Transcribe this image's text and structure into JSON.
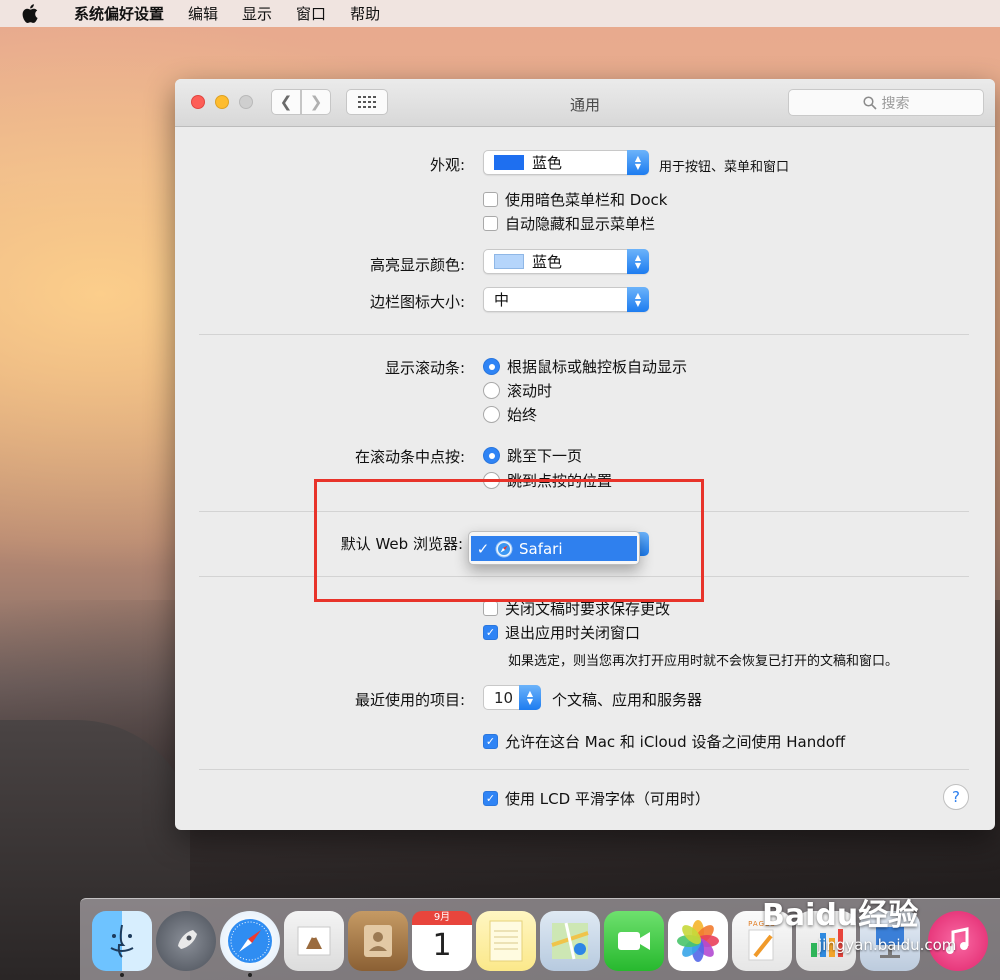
{
  "menubar": {
    "app": "系统偏好设置",
    "items": [
      "编辑",
      "显示",
      "窗口",
      "帮助"
    ]
  },
  "window": {
    "title": "通用",
    "search_placeholder": "搜索"
  },
  "appearance": {
    "label": "外观:",
    "value": "蓝色",
    "hint": "用于按钮、菜单和窗口",
    "swatch_color": "#1e6ff0",
    "dark_menu": "使用暗色菜单栏和 Dock",
    "auto_hide": "自动隐藏和显示菜单栏"
  },
  "highlight": {
    "label": "高亮显示颜色:",
    "value": "蓝色",
    "swatch_color": "#b5d5fb"
  },
  "sidebar_size": {
    "label": "边栏图标大小:",
    "value": "中"
  },
  "scrollbars": {
    "label": "显示滚动条:",
    "options": [
      "根据鼠标或触控板自动显示",
      "滚动时",
      "始终"
    ]
  },
  "click_scroll": {
    "label": "在滚动条中点按:",
    "options": [
      "跳至下一页",
      "跳到点按的位置"
    ]
  },
  "browser": {
    "label": "默认 Web 浏览器:",
    "tick": "✓",
    "value": "Safari"
  },
  "documents": {
    "ask_save": "关闭文稿时要求保存更改",
    "close_windows": "退出应用时关闭窗口",
    "note": "如果选定，则当您再次打开应用时就不会恢复已打开的文稿和窗口。"
  },
  "recent": {
    "label": "最近使用的项目:",
    "value": "10",
    "suffix": "个文稿、应用和服务器"
  },
  "handoff": "允许在这台 Mac 和 iCloud 设备之间使用 Handoff",
  "lcd": "使用 LCD 平滑字体（可用时）",
  "help": "?",
  "dock": {
    "calendar_month": "9月",
    "calendar_day": "1",
    "pages_label": "PAGES"
  },
  "watermark": {
    "logo": "Baidu经验",
    "url": "jingyan.baidu.com"
  }
}
